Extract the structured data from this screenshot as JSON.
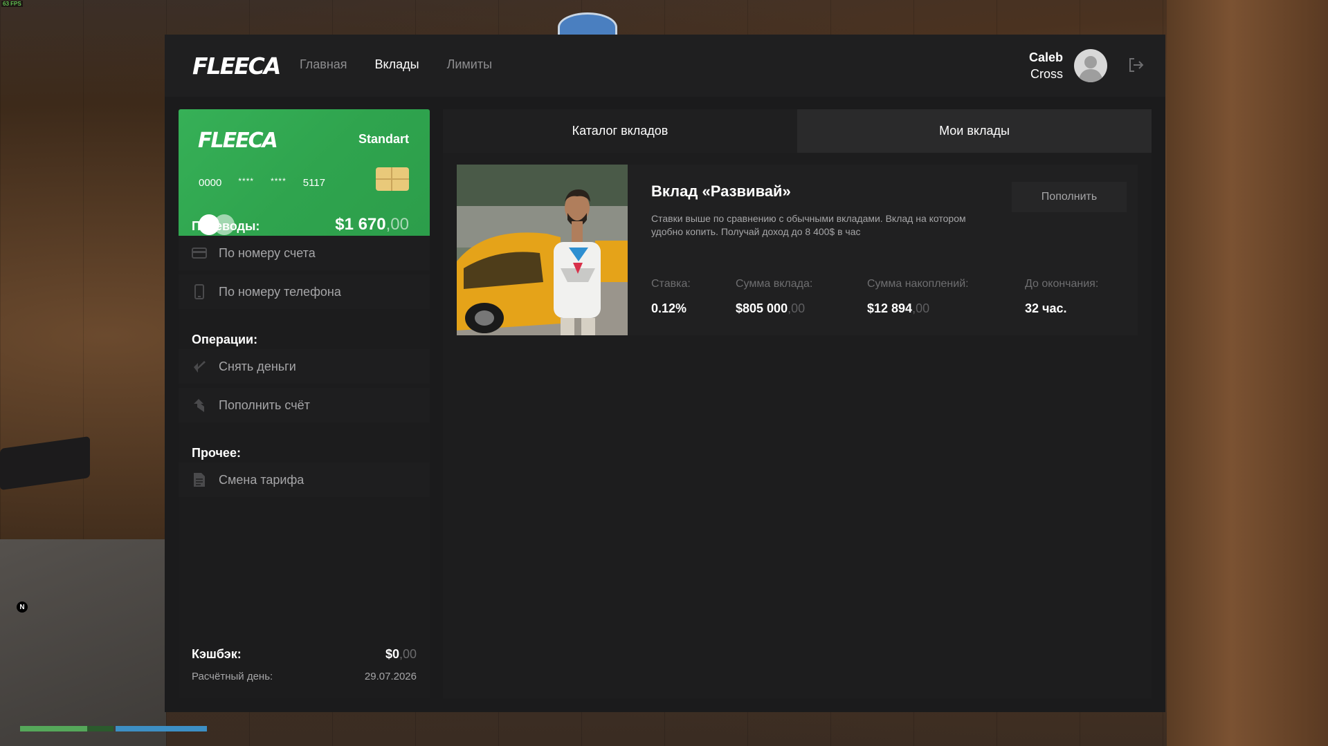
{
  "hud": {
    "fps": "63 FPS",
    "compass": "N",
    "health_fraction": 0.72,
    "armor_fraction": 1.0
  },
  "header": {
    "logo": "FLEECA",
    "nav": [
      "Главная",
      "Вклады",
      "Лимиты"
    ],
    "active_nav": "Вклады",
    "user_first": "Caleb",
    "user_last": "Cross"
  },
  "card": {
    "logo": "FLEECA",
    "tariff": "Standart",
    "number": [
      "0000",
      "****",
      "****",
      "5117"
    ],
    "balance_main": "$1 670",
    "balance_cents": ",00"
  },
  "sidebar": {
    "transfers_title": "Переводы:",
    "transfers": [
      "По номеру счета",
      "По номеру телефона"
    ],
    "operations_title": "Операции:",
    "operations": [
      "Снять деньги",
      "Пополнить счёт"
    ],
    "other_title": "Прочее:",
    "other": [
      "Смена тарифа"
    ],
    "cashback_label": "Кэшбэк:",
    "cashback_main": "$0",
    "cashback_cents": ",00",
    "billing_label": "Расчётный день:",
    "billing_date": "29.07.2026"
  },
  "tabs": [
    "Каталог вкладов",
    "Мои вклады"
  ],
  "active_tab": "Мои вклады",
  "deposit": {
    "title": "Вклад «Развивай»",
    "description": "Ставки выше по сравнению с обычными вкладами. Вклад на котором удобно копить. Получай доход до 8 400$ в час",
    "button": "Пополнить",
    "stats": [
      {
        "label": "Ставка:",
        "value": "0.12%",
        "cents": ""
      },
      {
        "label": "Сумма вклада:",
        "value": "$805 000",
        "cents": ",00"
      },
      {
        "label": "Сумма накоплений:",
        "value": "$12 894",
        "cents": ",00"
      },
      {
        "label": "До окончания:",
        "value": "32 час.",
        "cents": ""
      }
    ]
  },
  "colors": {
    "card_green": "#2fa44e",
    "panel_bg": "#1b1b1c",
    "muted_text": "#a6a6a8"
  }
}
